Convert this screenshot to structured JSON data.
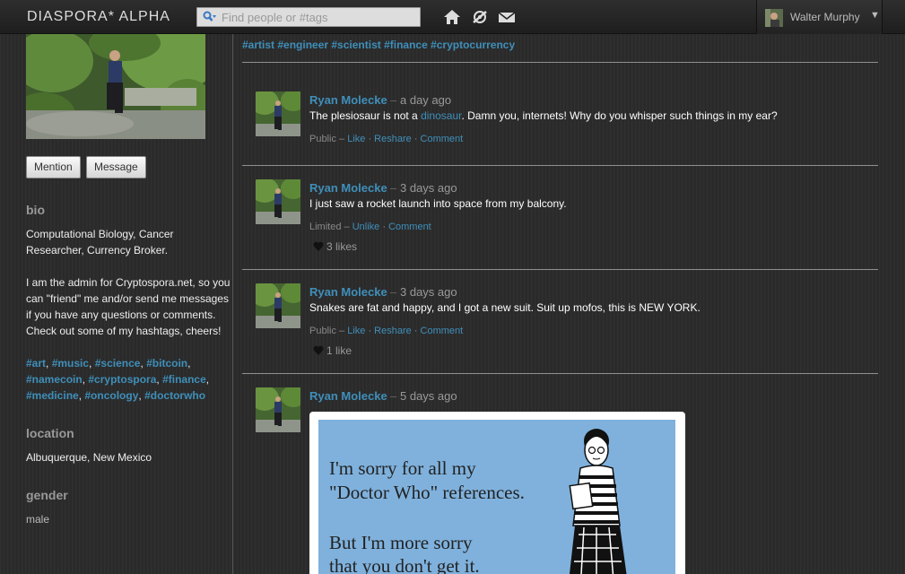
{
  "header": {
    "brand": "DIASPORA* ALPHA",
    "search_placeholder": "Find people or #tags",
    "user_name": "Walter Murphy",
    "caret": "▼"
  },
  "sidebar": {
    "mention_label": "Mention",
    "message_label": "Message",
    "bio_heading": "bio",
    "bio_line1": "Computational Biology, Cancer Researcher, Currency Broker.",
    "bio_line2": "I am the admin for Cryptospora.net, so you can \"friend\" me and/or send me messages if you have any questions or comments. Check out some of my hashtags, cheers!",
    "hashtags": [
      "#art",
      "#music",
      "#science",
      "#bitcoin",
      "#namecoin",
      "#cryptospora",
      "#finance",
      "#medicine",
      "#oncology",
      "#doctorwho"
    ],
    "location_heading": "location",
    "location": "Albuquerque, New Mexico",
    "gender_heading": "gender",
    "gender": "male"
  },
  "stream": {
    "profile_tags": "#artist #engineer #scientist #finance #cryptocurrency",
    "posts": [
      {
        "author": "Ryan Molecke",
        "time": "a day ago",
        "text_before": "The plesiosaur is not a ",
        "text_link": "dinosaur",
        "text_after": ". Damn you, internets! Why do you whisper such things in my ear?",
        "visibility": "Public",
        "actions": [
          "Like",
          "Reshare",
          "Comment"
        ]
      },
      {
        "author": "Ryan Molecke",
        "time": "3 days ago",
        "text": "I just saw a rocket launch into space from my balcony.",
        "visibility": "Limited",
        "actions": [
          "Unlike",
          "Comment"
        ],
        "likes": "3 likes"
      },
      {
        "author": "Ryan Molecke",
        "time": "3 days ago",
        "text": "Snakes are fat and happy, and I got a new suit. Suit up mofos, this is NEW YORK.",
        "visibility": "Public",
        "actions": [
          "Like",
          "Reshare",
          "Comment"
        ],
        "likes": "1 like"
      },
      {
        "author": "Ryan Molecke",
        "time": "5 days ago",
        "ecard_lines": [
          "I'm sorry for all my",
          "\"Doctor Who\" references.",
          "But I'm more sorry",
          "that you don't get it."
        ]
      }
    ]
  },
  "colors": {
    "link": "#3f8fba",
    "background": "#2b2b2b",
    "header": "#1e1e1e",
    "ecard_bg": "#7fb1dc"
  }
}
